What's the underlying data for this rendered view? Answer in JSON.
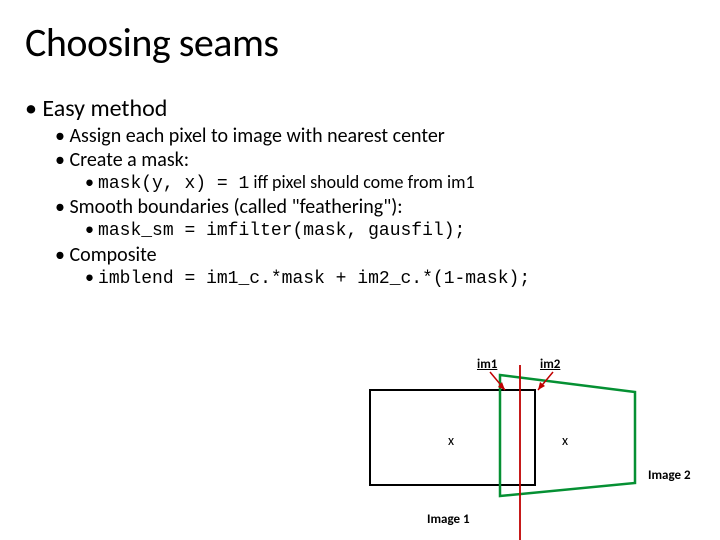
{
  "title": "Choosing seams",
  "bullets": {
    "l1": "Easy method",
    "l2a": "Assign each pixel to image with nearest center",
    "l2b": "Create a mask:",
    "l3a_pre": "mask(y, x) = 1",
    "l3a_post": " iff pixel should come from im1",
    "l2c": "Smooth boundaries (called \"feathering\"):",
    "l3b": "mask_sm = imfilter(mask, gausfil);",
    "l2d": "Composite",
    "l3c": "imblend = im1_c.*mask + im2_c.*(1-mask);"
  },
  "labels": {
    "im1": "im1",
    "im2": "im2",
    "image1": "Image 1",
    "image2": "Image 2",
    "x1": "x",
    "x2": "x"
  }
}
